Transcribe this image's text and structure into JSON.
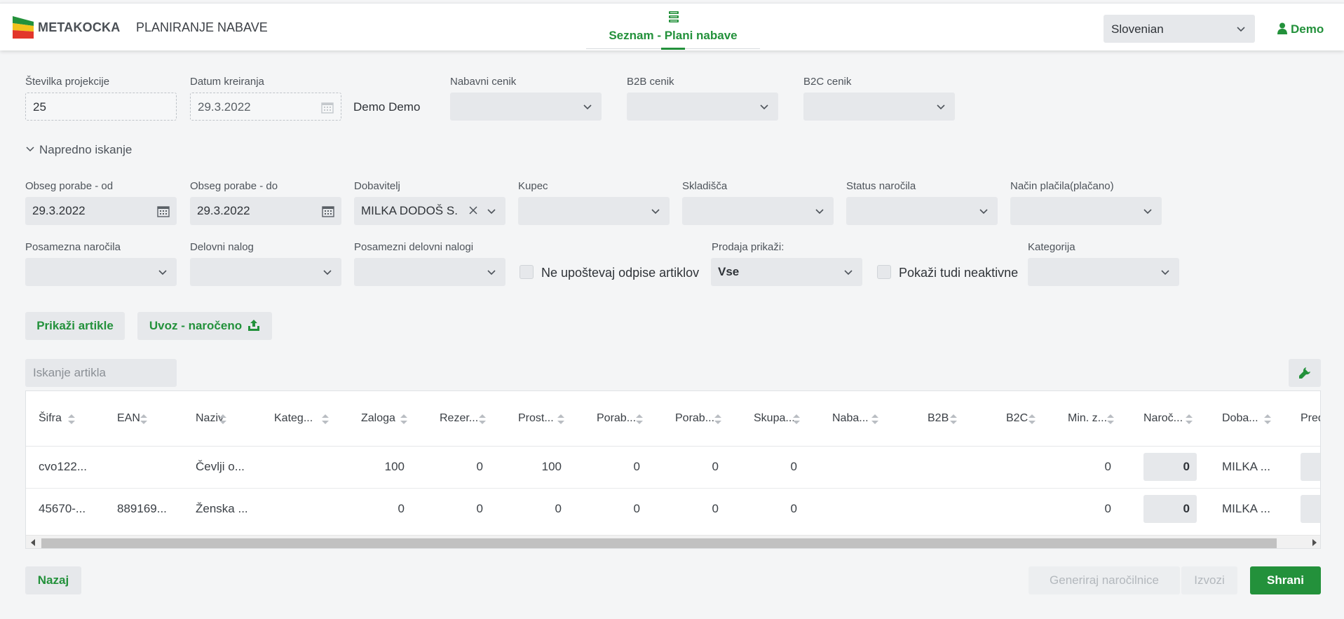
{
  "header": {
    "brand": "METAKOCKA",
    "module": "PLANIRANJE NABAVE",
    "tab_label": "Seznam - Plani nabave",
    "language": "Slovenian",
    "user": "Demo"
  },
  "form": {
    "projection_number": {
      "label": "Številka projekcije",
      "value": "25"
    },
    "created_date": {
      "label": "Datum kreiranja",
      "value": "29.3.2022"
    },
    "creator": "Demo Demo",
    "purchase_pricelist": {
      "label": "Nabavni cenik",
      "value": ""
    },
    "b2b_pricelist": {
      "label": "B2B cenik",
      "value": ""
    },
    "b2c_pricelist": {
      "label": "B2C cenik",
      "value": ""
    }
  },
  "advanced": {
    "toggle_label": "Napredno iskanje",
    "consumption_from": {
      "label": "Obseg porabe - od",
      "value": "29.3.2022"
    },
    "consumption_to": {
      "label": "Obseg porabe - do",
      "value": "29.3.2022"
    },
    "supplier": {
      "label": "Dobavitelj",
      "value": "MILKA DODOŠ S."
    },
    "customer": {
      "label": "Kupec",
      "value": ""
    },
    "warehouses": {
      "label": "Skladišča",
      "value": ""
    },
    "order_status": {
      "label": "Status naročila",
      "value": ""
    },
    "payment_method": {
      "label": "Način plačila(plačano)",
      "value": ""
    },
    "single_orders": {
      "label": "Posamezna naročila",
      "value": ""
    },
    "work_order": {
      "label": "Delovni nalog",
      "value": ""
    },
    "single_work_orders": {
      "label": "Posamezni delovni nalogi",
      "value": ""
    },
    "ignore_writeoffs": {
      "label": "Ne upoštevaj odpise artiklov",
      "checked": false
    },
    "sales_show": {
      "label": "Prodaja prikaži:",
      "value": "Vse"
    },
    "show_inactive": {
      "label": "Pokaži tudi neaktivne",
      "checked": false
    },
    "category": {
      "label": "Kategorija",
      "value": ""
    }
  },
  "actions": {
    "show_items": "Prikaži artikle",
    "import_ordered": "Uvoz - naročeno",
    "search_placeholder": "Iskanje artikla"
  },
  "table": {
    "columns": [
      "Šifra",
      "EAN",
      "Naziv",
      "Kateg...",
      "Zaloga",
      "Rezer...",
      "Prost...",
      "Porab...",
      "Porab...",
      "Skupa...",
      "Naba...",
      "B2B",
      "B2C",
      "Min. z...",
      "Naroč...",
      "Doba...",
      "Pred"
    ],
    "rows": [
      {
        "sifra": "cvo122...",
        "ean": "",
        "naziv": "Čevlji o...",
        "kategorija": "",
        "zaloga": "100",
        "rezervirano": "0",
        "prosto": "100",
        "poraba1": "0",
        "poraba2": "0",
        "skupaj": "0",
        "nabavna": "",
        "b2b": "",
        "b2c": "",
        "min_zaloga": "0",
        "naroceno": "0",
        "dobavitelj": "MILKA ..."
      },
      {
        "sifra": "45670-...",
        "ean": "889169...",
        "naziv": "Ženska ...",
        "kategorija": "",
        "zaloga": "0",
        "rezervirano": "0",
        "prosto": "0",
        "poraba1": "0",
        "poraba2": "0",
        "skupaj": "0",
        "nabavna": "",
        "b2b": "",
        "b2c": "",
        "min_zaloga": "0",
        "naroceno": "0",
        "dobavitelj": "MILKA ..."
      }
    ]
  },
  "footer": {
    "back": "Nazaj",
    "generate": "Generiraj naročilnice",
    "export": "Izvozi",
    "save": "Shrani"
  },
  "colors": {
    "accent": "#23913b",
    "field_bg": "#e6e8eb",
    "page_bg": "#f4f5f6"
  }
}
